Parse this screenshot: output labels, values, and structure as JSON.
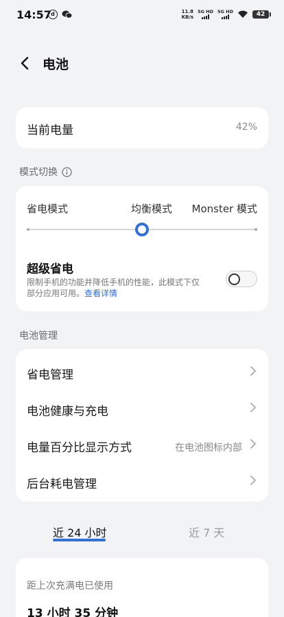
{
  "status_bar": {
    "time": "14:57",
    "net_speed_value": "11.8",
    "net_speed_unit": "KB/s",
    "sim1": "5G HD",
    "sim2": "5G HD",
    "battery": "42"
  },
  "header": {
    "title": "电池",
    "back_icon": "chevron-left-icon"
  },
  "current_battery": {
    "label": "当前电量",
    "value": "42%"
  },
  "mode_switch": {
    "section_title": "模式切换",
    "info_icon": "info-icon",
    "options": [
      "省电模式",
      "均衡模式",
      "Monster 模式"
    ],
    "selected": "均衡模式",
    "super_saver": {
      "title": "超级省电",
      "description": "限制手机的功能并降低手机的性能，此模式下仅部分应用可用。",
      "link": "查看详情",
      "enabled": false
    }
  },
  "battery_management": {
    "section_title": "电池管理",
    "items": [
      {
        "label": "省电管理",
        "value": ""
      },
      {
        "label": "电池健康与充电",
        "value": ""
      },
      {
        "label": "电量百分比显示方式",
        "value": "在电池图标内部"
      },
      {
        "label": "后台耗电管理",
        "value": ""
      }
    ]
  },
  "tabs": {
    "items": [
      "近 24 小时",
      "近 7 天"
    ],
    "active": "近 24 小时"
  },
  "usage": {
    "label": "距上次充满电已使用",
    "value": "13 小时 35 分钟"
  },
  "colors": {
    "accent": "#2f6fe0",
    "background": "#f2f3f5",
    "card": "#ffffff"
  }
}
